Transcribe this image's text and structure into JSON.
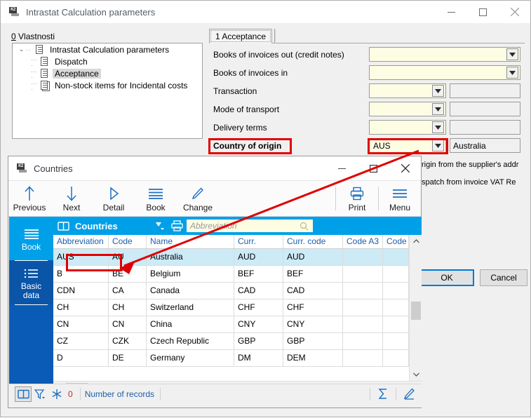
{
  "main_window": {
    "title": "Intrastat Calculation parameters",
    "icon": "k2-app-icon",
    "controls": {
      "minimize": "–",
      "maximize": "☐",
      "close": "✕"
    }
  },
  "left_panel": {
    "section_label_accesskey": "0",
    "section_label": " Vlastnosti",
    "tree": [
      {
        "label": "Intrastat Calculation parameters",
        "level": 0,
        "expanded": true,
        "selected": false
      },
      {
        "label": "Dispatch",
        "level": 1,
        "expanded": false,
        "selected": false
      },
      {
        "label": "Acceptance",
        "level": 1,
        "expanded": false,
        "selected": true
      },
      {
        "label": "Non-stock items for Incidental costs",
        "level": 1,
        "expanded": false,
        "selected": false
      }
    ]
  },
  "tabs": [
    {
      "label": "1 Acceptance",
      "active": true
    }
  ],
  "form": {
    "rows": [
      {
        "label": "Books of invoices out (credit notes)",
        "kind": "wide-combo",
        "value": "",
        "second": null,
        "highlight": false
      },
      {
        "label": "Books of invoices in",
        "kind": "wide-combo",
        "value": "",
        "second": null,
        "highlight": false
      },
      {
        "label": "Transaction",
        "kind": "narrow-combo",
        "value": "",
        "second": "",
        "highlight": false
      },
      {
        "label": "Mode of transport",
        "kind": "narrow-combo",
        "value": "",
        "second": "",
        "highlight": false
      },
      {
        "label": "Delivery terms",
        "kind": "narrow-combo",
        "value": "",
        "second": "",
        "highlight": false
      },
      {
        "label": "Country of origin",
        "kind": "narrow-combo",
        "value": "AUS",
        "second": "Australia",
        "highlight": true
      }
    ]
  },
  "obscured_text": {
    "line1": "rigin from the supplier's addr",
    "line2": "spatch  from invoice VAT Re"
  },
  "buttons": {
    "ok": "OK",
    "cancel": "Cancel"
  },
  "countries_dialog": {
    "title": "Countries",
    "icon": "k2-app-icon",
    "controls": {
      "minimize": "–",
      "maximize": "☐",
      "close": "✕"
    },
    "toolbar": [
      {
        "label": "Previous",
        "icon": "arrow-up-icon"
      },
      {
        "label": "Next",
        "icon": "arrow-down-icon"
      },
      {
        "label": "Detail",
        "icon": "play-triangle-icon"
      },
      {
        "label": "Book",
        "icon": "lines-icon"
      },
      {
        "label": "Change",
        "icon": "pencil-icon"
      }
    ],
    "toolbar_right": [
      {
        "label": "Print",
        "icon": "printer-icon"
      },
      {
        "label": "Menu",
        "icon": "hamburger-icon"
      }
    ],
    "sidebar": [
      {
        "label": "Book",
        "icon": "lines-icon",
        "active": true
      },
      {
        "label": "Basic\ndata",
        "label_line1": "Basic",
        "label_line2": "data",
        "icon": "list-icon",
        "active": false
      }
    ],
    "grid": {
      "title": "Countries",
      "title_icon": "book-open-icon",
      "search_placeholder": "Abbreviation",
      "search_value": "",
      "search_icon": "magnifier-icon",
      "tool_icons": [
        "printer-icon",
        "bar-chart-icon",
        "groups-icon",
        "columns-icon",
        "settings-icon",
        "hamburger-icon"
      ],
      "columns": [
        "Abbreviation",
        "Code",
        "Name",
        "Curr.",
        "Curr. code",
        "Code A3",
        "Code"
      ],
      "rows": [
        {
          "abbreviation": "AUS",
          "code": "AU",
          "name": "Australia",
          "curr": "AUD",
          "curr_code": "AUD",
          "code_a3": "",
          "code2": "",
          "selected": true
        },
        {
          "abbreviation": "B",
          "code": "BE",
          "name": "Belgium",
          "curr": "BEF",
          "curr_code": "BEF",
          "code_a3": "",
          "code2": "",
          "selected": false
        },
        {
          "abbreviation": "CDN",
          "code": "CA",
          "name": "Canada",
          "curr": "CAD",
          "curr_code": "CAD",
          "code_a3": "",
          "code2": "",
          "selected": false
        },
        {
          "abbreviation": "CH",
          "code": "CH",
          "name": "Switzerland",
          "curr": "CHF",
          "curr_code": "CHF",
          "code_a3": "",
          "code2": "",
          "selected": false
        },
        {
          "abbreviation": "CN",
          "code": "CN",
          "name": "China",
          "curr": "CNY",
          "curr_code": "CNY",
          "code_a3": "",
          "code2": "",
          "selected": false
        },
        {
          "abbreviation": "CZ",
          "code": "CZK",
          "name": "Czech Republic",
          "curr": "GBP",
          "curr_code": "GBP",
          "code_a3": "",
          "code2": "",
          "selected": false
        },
        {
          "abbreviation": "D",
          "code": "DE",
          "name": "Germany",
          "curr": "DM",
          "curr_code": "DEM",
          "code_a3": "",
          "code2": "",
          "selected": false
        }
      ]
    },
    "status_bar": {
      "book_icon": "book-open-icon",
      "filter_icon": "funnel-icon",
      "snowflake_icon": "snowflake-icon",
      "count": "0",
      "records_label": "Number of records",
      "sum_icon": "sigma-icon",
      "edit_icon": "pencil-icon"
    }
  },
  "colors": {
    "accent_blue": "#00a0e9",
    "sidebar_blue": "#0a5bb5",
    "highlight_red": "#e00000",
    "field_yellow": "#fdfde4",
    "row_selected": "#cdeaf7",
    "header_text_blue": "#1e5fa8"
  }
}
